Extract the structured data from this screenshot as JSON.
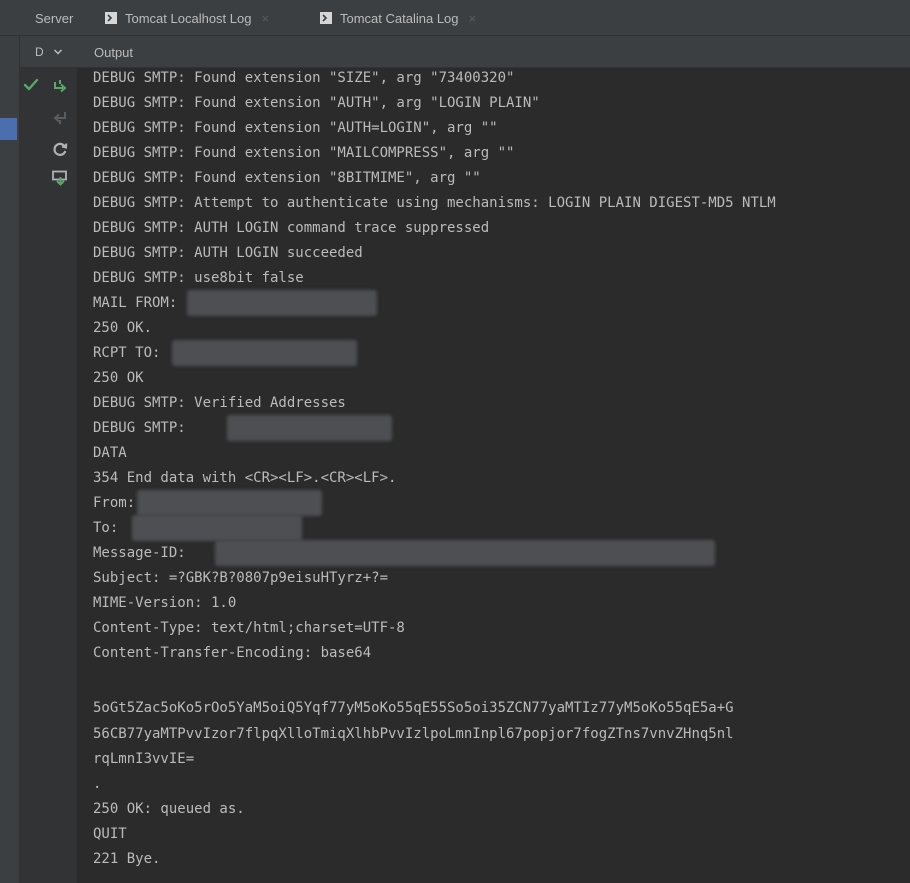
{
  "tabs": {
    "server": "Server",
    "localhost_log": "Tomcat Localhost Log",
    "catalina_log": "Tomcat Catalina Log",
    "close_glyph": "×"
  },
  "toolbar": {
    "dropdown_label": "D",
    "output_label": "Output"
  },
  "icons": {
    "tab_icon": "console-icon",
    "gutter": [
      "check-icon",
      "deploy-arrow-icon",
      "undeploy-arrow-icon",
      "refresh-icon",
      "update-icon"
    ]
  },
  "colors": {
    "background": "#2b2b2b",
    "text": "#bbbbbb",
    "accent_green": "#59a869",
    "selection_blue": "#4b6eaf"
  },
  "console_lines": [
    "DEBUG SMTP: Found extension \"SIZE\", arg \"73400320\"",
    "DEBUG SMTP: Found extension \"AUTH\", arg \"LOGIN PLAIN\"",
    "DEBUG SMTP: Found extension \"AUTH=LOGIN\", arg \"\"",
    "DEBUG SMTP: Found extension \"MAILCOMPRESS\", arg \"\"",
    "DEBUG SMTP: Found extension \"8BITMIME\", arg \"\"",
    "DEBUG SMTP: Attempt to authenticate using mechanisms: LOGIN PLAIN DIGEST-MD5 NTLM",
    "DEBUG SMTP: AUTH LOGIN command trace suppressed",
    "DEBUG SMTP: AUTH LOGIN succeeded",
    "DEBUG SMTP: use8bit false",
    "MAIL FROM:",
    "250 OK.",
    "RCPT TO:",
    "250 OK",
    "DEBUG SMTP: Verified Addresses",
    "DEBUG SMTP:",
    "DATA",
    "354 End data with <CR><LF>.<CR><LF>.",
    "From:",
    "To:",
    "Message-ID:",
    "Subject: =?GBK?B?0807p9eisuHTyrz+?=",
    "MIME-Version: 1.0",
    "Content-Type: text/html;charset=UTF-8",
    "Content-Transfer-Encoding: base64",
    "",
    "5oGt5Zac5oKo5rOo5YaM5oiQ5Yqf77yM5oKo55qE55So5oi35ZCN77yaMTIz77yM5oKo55qE5a+G",
    "56CB77yaMTPvvIzor7flpqXlloTmiqXlhbPvvIzlpoLmnInpl67popjor7fogZTns7vnvZHnq5nl",
    "rqLmnI3vvIE=",
    ".",
    "250 OK: queued as.",
    "QUIT",
    "221 Bye."
  ]
}
